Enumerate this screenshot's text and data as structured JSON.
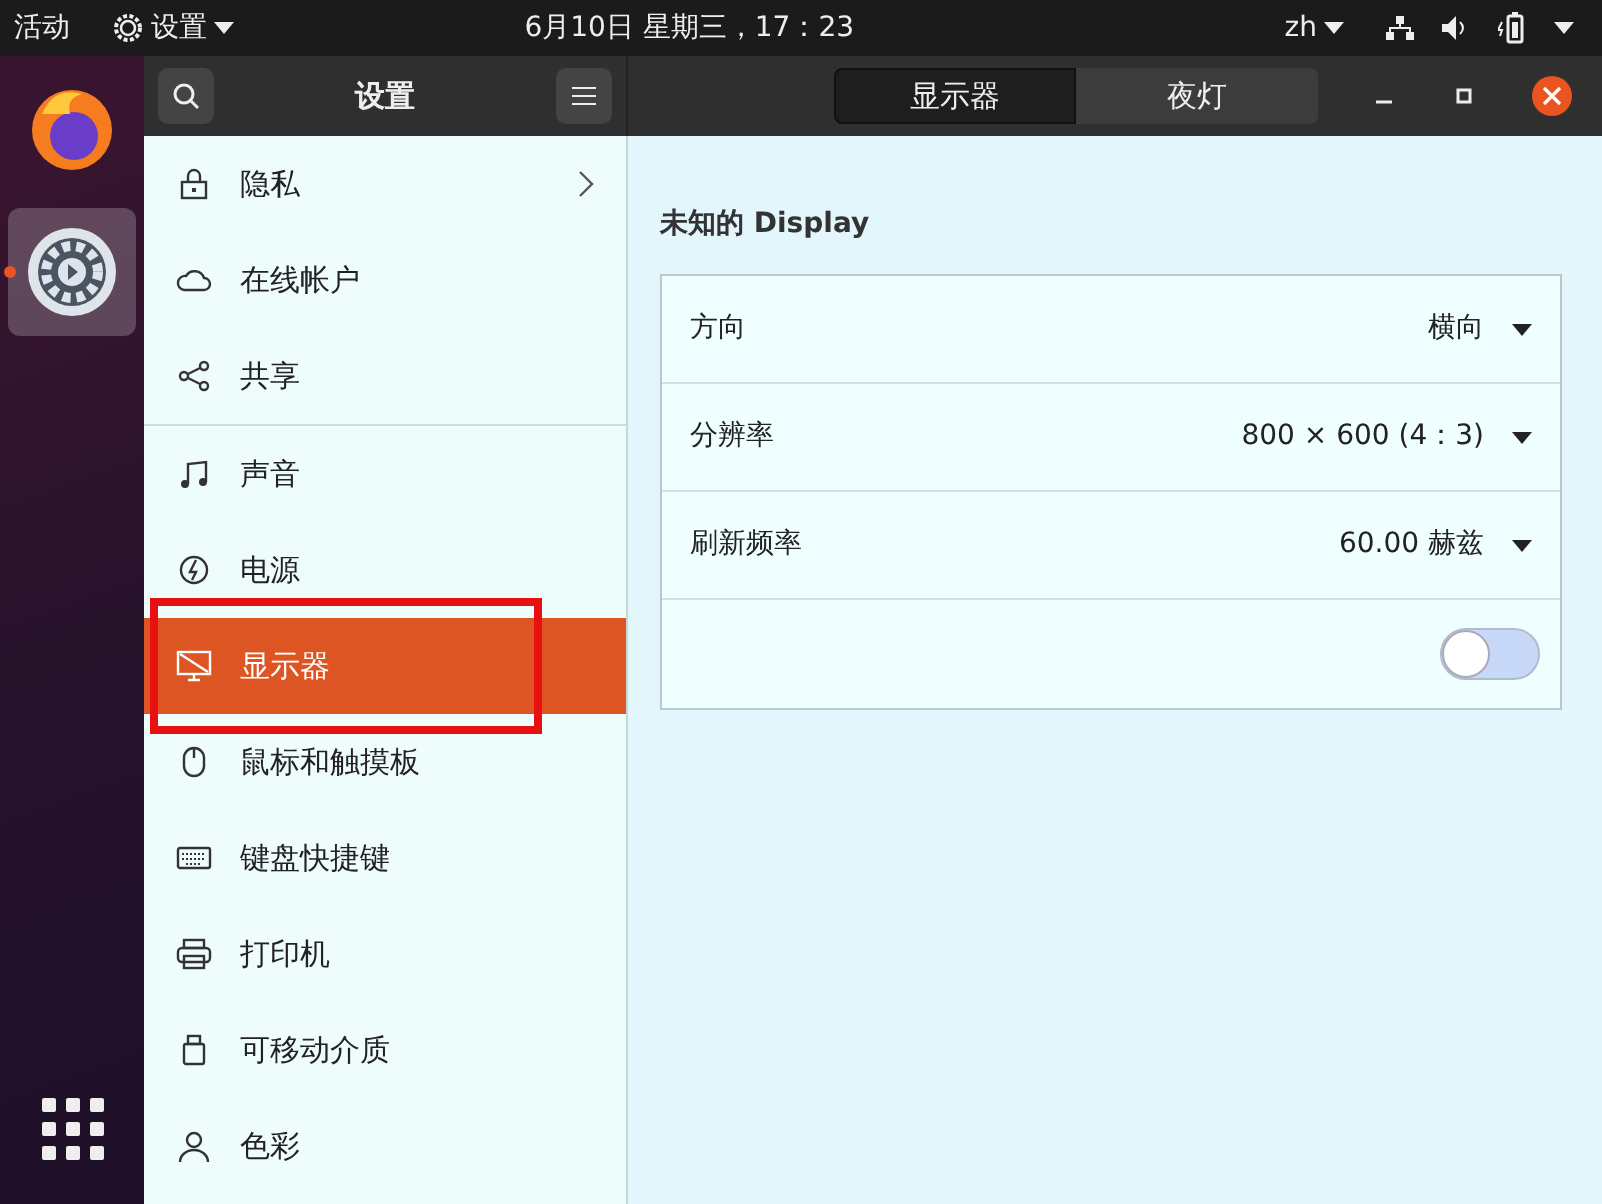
{
  "top_bar": {
    "activities": "活动",
    "app_menu": "设置",
    "clock": "6月10日 星期三，17：23",
    "input_method": "zh"
  },
  "dock": {
    "items": [
      {
        "kind": "browser",
        "selected": false,
        "running": false
      },
      {
        "kind": "settings",
        "selected": true,
        "running": true
      }
    ]
  },
  "header": {
    "title": "设置",
    "view_tabs": [
      {
        "label": "显示器",
        "selected": true
      },
      {
        "label": "夜灯",
        "selected": false
      }
    ]
  },
  "sidebar": {
    "groups": [
      [
        {
          "label": "隐私",
          "kind": "lock",
          "submenu": true,
          "selected": false,
          "highlighted": false
        },
        {
          "label": "在线帐户",
          "kind": "cloud",
          "submenu": false,
          "selected": false,
          "highlighted": false
        },
        {
          "label": "共享",
          "kind": "share",
          "submenu": false,
          "selected": false,
          "highlighted": false
        }
      ],
      [
        {
          "label": "声音",
          "kind": "music",
          "submenu": false,
          "selected": false,
          "highlighted": false
        },
        {
          "label": "电源",
          "kind": "power",
          "submenu": false,
          "selected": false,
          "highlighted": false
        },
        {
          "label": "显示器",
          "kind": "display",
          "submenu": false,
          "selected": true,
          "highlighted": true
        },
        {
          "label": "鼠标和触摸板",
          "kind": "mouse",
          "submenu": false,
          "selected": false,
          "highlighted": false
        },
        {
          "label": "键盘快捷键",
          "kind": "keyboard",
          "submenu": false,
          "selected": false,
          "highlighted": false
        },
        {
          "label": "打印机",
          "kind": "printer",
          "submenu": false,
          "selected": false,
          "highlighted": false
        },
        {
          "label": "可移动介质",
          "kind": "usb",
          "submenu": false,
          "selected": false,
          "highlighted": false
        },
        {
          "label": "色彩",
          "kind": "person",
          "submenu": false,
          "selected": false,
          "highlighted": false
        }
      ]
    ]
  },
  "display": {
    "title": "未知的 Display",
    "rows": [
      {
        "label": "方向",
        "value": "横向"
      },
      {
        "label": "分辨率",
        "value": "800 × 600 (4：3)"
      },
      {
        "label": "刷新频率",
        "value": "60.00 赫兹"
      }
    ],
    "toggle": {
      "on": false
    }
  }
}
